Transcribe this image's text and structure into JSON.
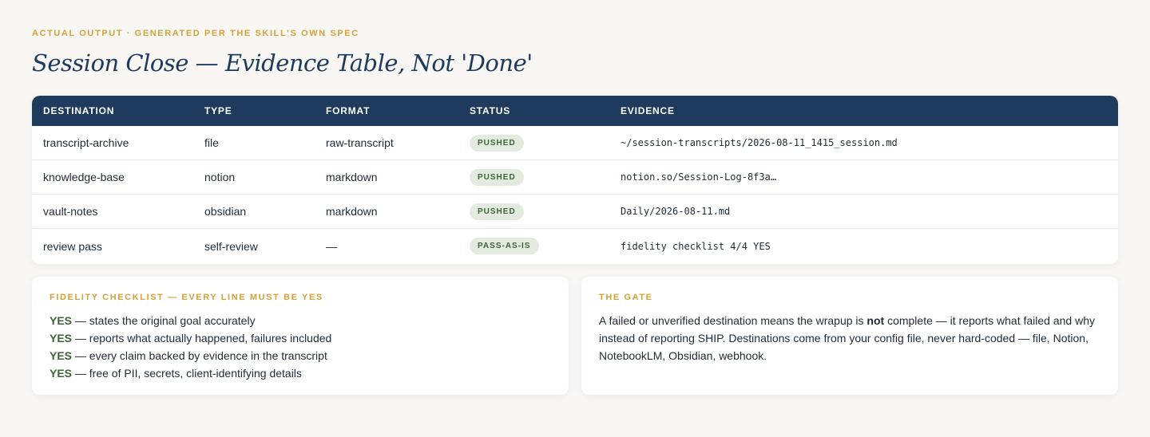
{
  "eyebrow": "ACTUAL OUTPUT · GENERATED PER THE SKILL'S OWN SPEC",
  "title": "Session Close — Evidence Table, Not 'Done'",
  "table": {
    "headers": [
      "DESTINATION",
      "TYPE",
      "FORMAT",
      "STATUS",
      "EVIDENCE"
    ],
    "rows": [
      {
        "destination": "transcript-archive",
        "type": "file",
        "format": "raw-transcript",
        "status": "PUSHED",
        "evidence": "~/session-transcripts/2026-08-11_1415_session.md"
      },
      {
        "destination": "knowledge-base",
        "type": "notion",
        "format": "markdown",
        "status": "PUSHED",
        "evidence": "notion.so/Session-Log-8f3a…"
      },
      {
        "destination": "vault-notes",
        "type": "obsidian",
        "format": "markdown",
        "status": "PUSHED",
        "evidence": "Daily/2026-08-11.md"
      },
      {
        "destination": "review pass",
        "type": "self-review",
        "format": "—",
        "status": "PASS-AS-IS",
        "evidence": "fidelity checklist 4/4 YES"
      }
    ]
  },
  "checklist": {
    "title": "FIDELITY CHECKLIST — EVERY LINE MUST BE YES",
    "items": [
      {
        "mark": "YES",
        "text": " — states the original goal accurately"
      },
      {
        "mark": "YES",
        "text": " — reports what actually happened, failures included"
      },
      {
        "mark": "YES",
        "text": " — every claim backed by evidence in the transcript"
      },
      {
        "mark": "YES",
        "text": " — free of PII, secrets, client-identifying details"
      }
    ]
  },
  "gate": {
    "title": "THE GATE",
    "text_before": "A failed or unverified destination means the wrapup is ",
    "text_bold": "not",
    "text_after": " complete — it reports what failed and why instead of reporting SHIP. Destinations come from your config file, never hard-coded — file, Notion, NotebookLM, Obsidian, webhook."
  },
  "colors": {
    "accent": "#d4a23a",
    "header_bg": "#1e3a5c",
    "badge_bg": "#e3ebe0",
    "badge_text": "#3d6437"
  }
}
